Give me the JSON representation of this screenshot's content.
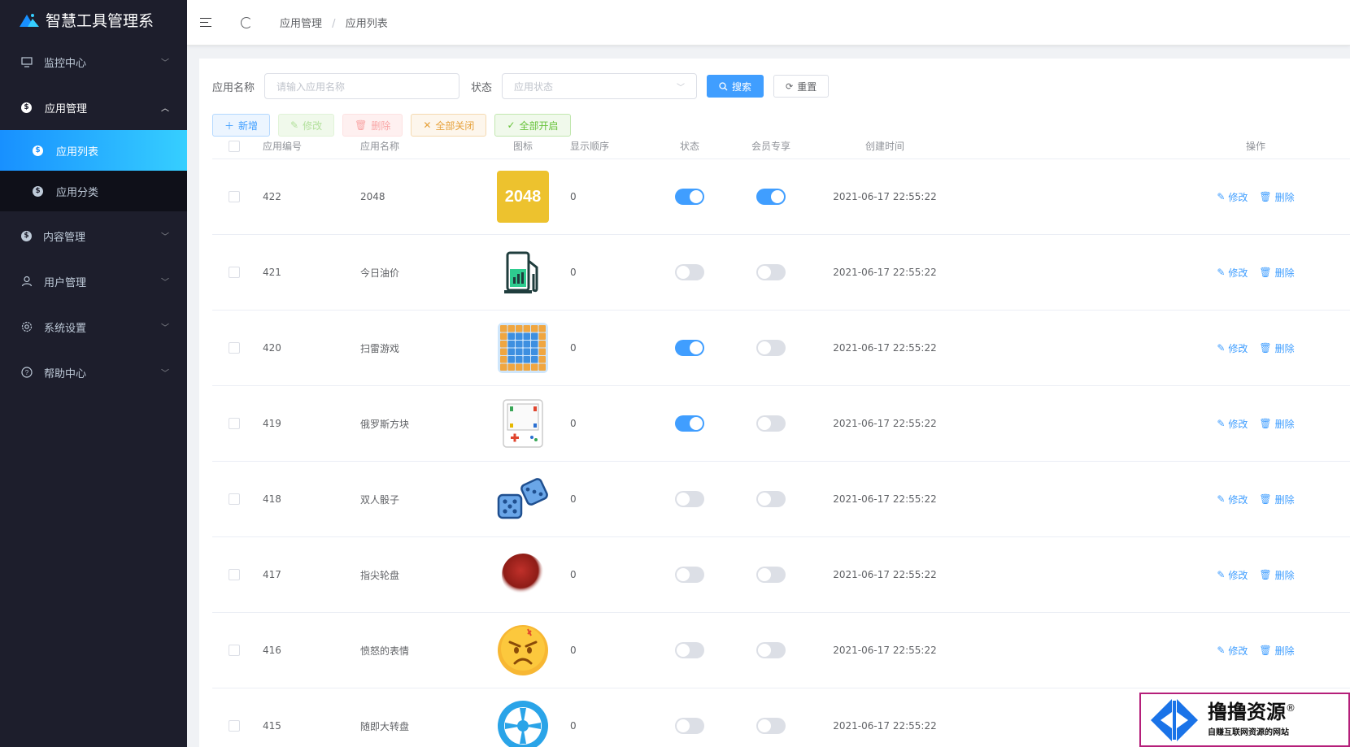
{
  "app": {
    "title": "智慧工具管理系"
  },
  "sidebar": {
    "items": [
      {
        "label": "监控中心",
        "icon": "monitor-icon",
        "expanded": false
      },
      {
        "label": "应用管理",
        "icon": "dollar-icon",
        "expanded": true,
        "children": [
          {
            "label": "应用列表",
            "active": true
          },
          {
            "label": "应用分类",
            "active": false
          }
        ]
      },
      {
        "label": "内容管理",
        "icon": "dollar-icon",
        "expanded": false
      },
      {
        "label": "用户管理",
        "icon": "user-icon",
        "expanded": false
      },
      {
        "label": "系统设置",
        "icon": "gear-icon",
        "expanded": false
      },
      {
        "label": "帮助中心",
        "icon": "help-icon",
        "expanded": false
      }
    ]
  },
  "header": {
    "breadcrumb": [
      "应用管理",
      "应用列表"
    ],
    "separator": "/"
  },
  "search": {
    "name_label": "应用名称",
    "name_placeholder": "请输入应用名称",
    "status_label": "状态",
    "status_placeholder": "应用状态",
    "search_label": "搜索",
    "reset_label": "重置"
  },
  "toolbar": {
    "add": "新增",
    "edit": "修改",
    "delete": "删除",
    "all_off": "全部关闭",
    "all_on": "全部开启"
  },
  "table": {
    "columns": [
      "应用编号",
      "应用名称",
      "图标",
      "显示顺序",
      "状态",
      "会员专享",
      "创建时间",
      "操作"
    ],
    "edit_label": "修改",
    "delete_label": "删除",
    "rows": [
      {
        "id": "422",
        "name": "2048",
        "icon": "game-2048-icon",
        "icon_text": "2048",
        "order": "0",
        "status": true,
        "vip": true,
        "time": "2021-06-17 22:55:22"
      },
      {
        "id": "421",
        "name": "今日油价",
        "icon": "fuel-pump-icon",
        "order": "0",
        "status": false,
        "vip": false,
        "time": "2021-06-17 22:55:22"
      },
      {
        "id": "420",
        "name": "扫雷游戏",
        "icon": "minesweeper-icon",
        "order": "0",
        "status": true,
        "vip": false,
        "time": "2021-06-17 22:55:22"
      },
      {
        "id": "419",
        "name": "俄罗斯方块",
        "icon": "tetris-console-icon",
        "order": "0",
        "status": true,
        "vip": false,
        "time": "2021-06-17 22:55:22"
      },
      {
        "id": "418",
        "name": "双人骰子",
        "icon": "dice-icon",
        "order": "0",
        "status": false,
        "vip": false,
        "time": "2021-06-17 22:55:22"
      },
      {
        "id": "417",
        "name": "指尖轮盘",
        "icon": "red-ball-icon",
        "order": "0",
        "status": false,
        "vip": false,
        "time": "2021-06-17 22:55:22"
      },
      {
        "id": "416",
        "name": "愤怒的表情",
        "icon": "angry-face-icon",
        "order": "0",
        "status": false,
        "vip": false,
        "time": "2021-06-17 22:55:22"
      },
      {
        "id": "415",
        "name": "随即大转盘",
        "icon": "wheel-icon",
        "order": "0",
        "status": false,
        "vip": false,
        "time": "2021-06-17 22:55:22"
      }
    ]
  },
  "watermark": {
    "title": "撸撸资源",
    "subtitle": "自赚互联网资源的网站",
    "mark": "®"
  }
}
